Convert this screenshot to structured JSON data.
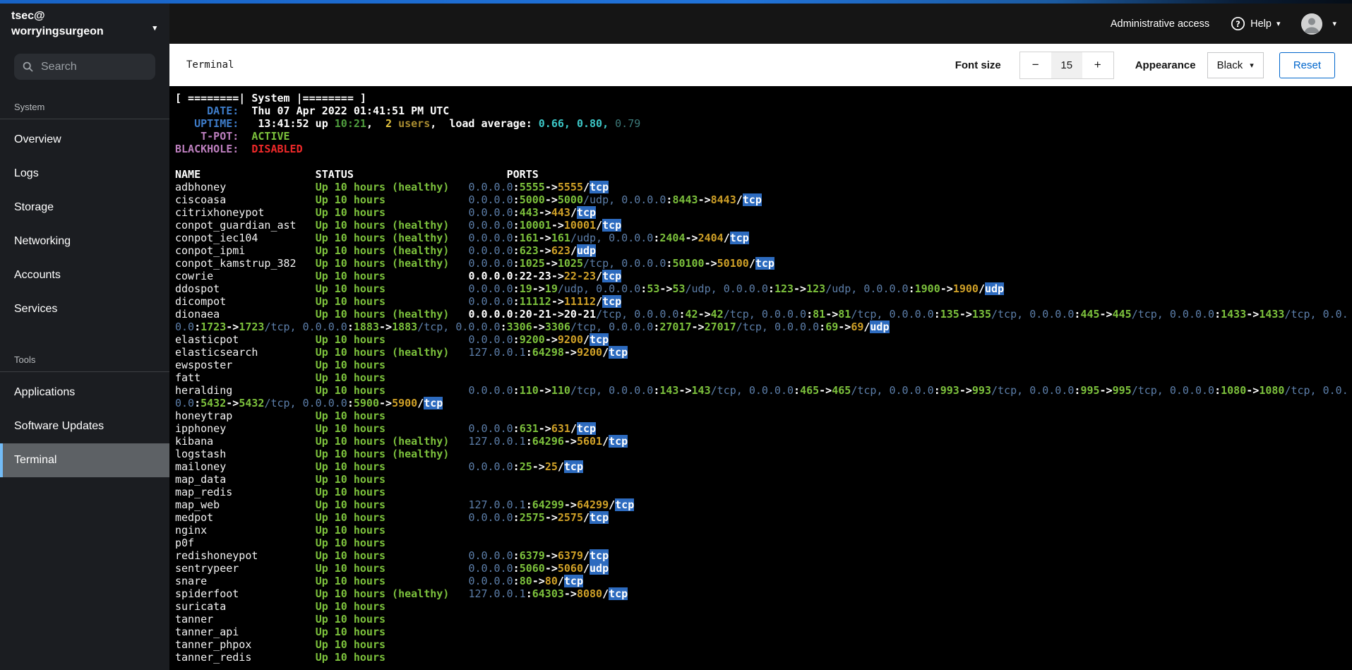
{
  "masthead": {
    "user": "tsec@",
    "host": "worryingsurgeon",
    "admin_access_label": "Administrative access",
    "help_label": "Help"
  },
  "sidebar": {
    "search_placeholder": "Search",
    "sections": [
      {
        "title": "System",
        "items": [
          {
            "label": "Overview",
            "current": false
          },
          {
            "label": "Logs",
            "current": false
          },
          {
            "label": "Storage",
            "current": false
          },
          {
            "label": "Networking",
            "current": false
          },
          {
            "label": "Accounts",
            "current": false
          },
          {
            "label": "Services",
            "current": false
          }
        ]
      },
      {
        "title": "Tools",
        "items": [
          {
            "label": "Applications",
            "current": false
          },
          {
            "label": "Software Updates",
            "current": false
          },
          {
            "label": "Terminal",
            "current": true
          }
        ]
      }
    ]
  },
  "toolbar": {
    "title": "Terminal",
    "font_size_label": "Font size",
    "minus_label": "−",
    "font_size_value": "15",
    "plus_label": "+",
    "appearance_label": "Appearance",
    "appearance_value": "Black",
    "reset_label": "Reset"
  },
  "colors": {
    "accent_blue": "#1863c6",
    "masthead_bg": "#151515",
    "sidebar_bg": "#1b1d21",
    "selected_bg": "#5d6165",
    "selected_border": "#73bcf7",
    "link_blue": "#0066cc",
    "terminal_bg": "#000000",
    "terminal_green": "#7cc13c",
    "terminal_yellow": "#cfa027",
    "terminal_steel_blue": "#5c7ea9",
    "terminal_label_blue": "#3e7cc9",
    "terminal_purple": "#bd7fbe",
    "terminal_red": "#ef2929",
    "terminal_cyan": "#3cc8c8",
    "highlight_bg": "#2d6bbf"
  },
  "terminal": {
    "status_up": "Up 10 hours",
    "status_healthy": "Up 10 hours (healthy)",
    "lines": [
      {
        "segs": [
          [
            "[ ========| System |======== ]",
            "wb"
          ]
        ]
      },
      {
        "segs": [
          [
            "     DATE:",
            "lb"
          ],
          [
            "  Thu 07 Apr 2022 01:41:51 PM UTC",
            "wb"
          ]
        ]
      },
      {
        "segs": [
          [
            "   UPTIME:",
            "lb"
          ],
          [
            "   13:41:52 up ",
            "wb"
          ],
          [
            "10:21",
            "dg"
          ],
          [
            ",  ",
            "wb"
          ],
          [
            "2",
            "by"
          ],
          [
            " ",
            "wb"
          ],
          [
            "users",
            "oy"
          ],
          [
            ",  load average: ",
            "wb"
          ],
          [
            "0.66, ",
            "cy"
          ],
          [
            "0.80, ",
            "cy"
          ],
          [
            "0.79",
            "cyd"
          ]
        ]
      },
      {
        "segs": [
          [
            "    T-POT:",
            "pu"
          ],
          [
            "  ",
            "wb"
          ],
          [
            "ACTIVE",
            "g"
          ]
        ]
      },
      {
        "segs": [
          [
            "BLACKHOLE:",
            "pu"
          ],
          [
            "  ",
            "wb"
          ],
          [
            "DISABLED",
            "r"
          ]
        ]
      },
      {
        "segs": []
      },
      {
        "segs": [
          [
            "NAME                  STATUS                        PORTS",
            "wb"
          ]
        ]
      },
      {
        "name": "adbhoney",
        "healthy": true,
        "ports": [
          [
            "0.0.0.0",
            "5555",
            "5555",
            "tcp",
            "f"
          ]
        ]
      },
      {
        "name": "ciscoasa",
        "healthy": false,
        "ports": [
          [
            "0.0.0.0",
            "5000",
            "5000",
            "udp",
            ""
          ],
          [
            "0.0.0.0",
            "8443",
            "8443",
            "tcp",
            "f"
          ]
        ]
      },
      {
        "name": "citrixhoneypot",
        "healthy": false,
        "ports": [
          [
            "0.0.0.0",
            "443",
            "443",
            "tcp",
            "f"
          ]
        ]
      },
      {
        "name": "conpot_guardian_ast",
        "healthy": true,
        "ports": [
          [
            "0.0.0.0",
            "10001",
            "10001",
            "tcp",
            "f"
          ]
        ]
      },
      {
        "name": "conpot_iec104",
        "healthy": true,
        "ports": [
          [
            "0.0.0.0",
            "161",
            "161",
            "udp",
            ""
          ],
          [
            "0.0.0.0",
            "2404",
            "2404",
            "tcp",
            "f"
          ]
        ]
      },
      {
        "name": "conpot_ipmi",
        "healthy": true,
        "ports": [
          [
            "0.0.0.0",
            "623",
            "623",
            "udp",
            "f"
          ]
        ]
      },
      {
        "name": "conpot_kamstrup_382",
        "healthy": true,
        "ports": [
          [
            "0.0.0.0",
            "1025",
            "1025",
            "tcp",
            ""
          ],
          [
            "0.0.0.0",
            "50100",
            "50100",
            "tcp",
            "f"
          ]
        ]
      },
      {
        "name": "cowrie",
        "healthy": false,
        "ports": [
          [
            "0.0.0.0",
            "22-23",
            "22-23",
            "tcp",
            "fw"
          ]
        ]
      },
      {
        "name": "ddospot",
        "healthy": false,
        "ports": [
          [
            "0.0.0.0",
            "19",
            "19",
            "udp",
            ""
          ],
          [
            "0.0.0.0",
            "53",
            "53",
            "udp",
            ""
          ],
          [
            "0.0.0.0",
            "123",
            "123",
            "udp",
            ""
          ],
          [
            "0.0.0.0",
            "1900",
            "1900",
            "udp",
            "f"
          ]
        ]
      },
      {
        "name": "dicompot",
        "healthy": false,
        "ports": [
          [
            "0.0.0.0",
            "11112",
            "11112",
            "tcp",
            "f"
          ]
        ]
      },
      {
        "name": "dionaea",
        "healthy": true,
        "ports": [
          [
            "0.0.0.0",
            "20-21",
            "20-21",
            "tcp",
            "w"
          ],
          [
            "0.0.0.0",
            "42",
            "42",
            "tcp",
            ""
          ],
          [
            "0.0.0.0",
            "81",
            "81",
            "tcp",
            ""
          ],
          [
            "0.0.0.0",
            "135",
            "135",
            "tcp",
            ""
          ],
          [
            "0.0.0.0",
            "445",
            "445",
            "tcp",
            ""
          ],
          [
            "0.0.0.0",
            "1433",
            "1433",
            "tcp",
            ""
          ]
        ],
        "tail": "0.0."
      },
      {
        "ports": [
          [
            "0.0",
            "1723",
            "1723",
            "tcp",
            ""
          ],
          [
            "0.0.0.0",
            "1883",
            "1883",
            "tcp",
            ""
          ],
          [
            "0.0.0.0",
            "3306",
            "3306",
            "tcp",
            ""
          ],
          [
            "0.0.0.0",
            "27017",
            "27017",
            "tcp",
            ""
          ],
          [
            "0.0.0.0",
            "69",
            "69",
            "udp",
            "f"
          ]
        ]
      },
      {
        "name": "elasticpot",
        "healthy": false,
        "ports": [
          [
            "0.0.0.0",
            "9200",
            "9200",
            "tcp",
            "f"
          ]
        ]
      },
      {
        "name": "elasticsearch",
        "healthy": true,
        "ports": [
          [
            "127.0.0.1",
            "64298",
            "9200",
            "tcp",
            "f"
          ]
        ]
      },
      {
        "name": "ewsposter",
        "healthy": false,
        "ports": []
      },
      {
        "name": "fatt",
        "healthy": false,
        "ports": []
      },
      {
        "name": "heralding",
        "healthy": false,
        "ports": [
          [
            "0.0.0.0",
            "110",
            "110",
            "tcp",
            ""
          ],
          [
            "0.0.0.0",
            "143",
            "143",
            "tcp",
            ""
          ],
          [
            "0.0.0.0",
            "465",
            "465",
            "tcp",
            ""
          ],
          [
            "0.0.0.0",
            "993",
            "993",
            "tcp",
            ""
          ],
          [
            "0.0.0.0",
            "995",
            "995",
            "tcp",
            ""
          ],
          [
            "0.0.0.0",
            "1080",
            "1080",
            "tcp",
            ""
          ]
        ],
        "tail": "0.0."
      },
      {
        "ports": [
          [
            "0.0",
            "5432",
            "5432",
            "tcp",
            ""
          ],
          [
            "0.0.0.0",
            "5900",
            "5900",
            "tcp",
            "f"
          ]
        ]
      },
      {
        "name": "honeytrap",
        "healthy": false,
        "ports": []
      },
      {
        "name": "ipphoney",
        "healthy": false,
        "ports": [
          [
            "0.0.0.0",
            "631",
            "631",
            "tcp",
            "f"
          ]
        ]
      },
      {
        "name": "kibana",
        "healthy": true,
        "ports": [
          [
            "127.0.0.1",
            "64296",
            "5601",
            "tcp",
            "f"
          ]
        ]
      },
      {
        "name": "logstash",
        "healthy": true,
        "ports": []
      },
      {
        "name": "mailoney",
        "healthy": false,
        "ports": [
          [
            "0.0.0.0",
            "25",
            "25",
            "tcp",
            "f"
          ]
        ]
      },
      {
        "name": "map_data",
        "healthy": false,
        "ports": []
      },
      {
        "name": "map_redis",
        "healthy": false,
        "ports": []
      },
      {
        "name": "map_web",
        "healthy": false,
        "ports": [
          [
            "127.0.0.1",
            "64299",
            "64299",
            "tcp",
            "f"
          ]
        ]
      },
      {
        "name": "medpot",
        "healthy": false,
        "ports": [
          [
            "0.0.0.0",
            "2575",
            "2575",
            "tcp",
            "f"
          ]
        ]
      },
      {
        "name": "nginx",
        "healthy": false,
        "ports": []
      },
      {
        "name": "p0f",
        "healthy": false,
        "ports": []
      },
      {
        "name": "redishoneypot",
        "healthy": false,
        "ports": [
          [
            "0.0.0.0",
            "6379",
            "6379",
            "tcp",
            "f"
          ]
        ]
      },
      {
        "name": "sentrypeer",
        "healthy": false,
        "ports": [
          [
            "0.0.0.0",
            "5060",
            "5060",
            "udp",
            "f"
          ]
        ]
      },
      {
        "name": "snare",
        "healthy": false,
        "ports": [
          [
            "0.0.0.0",
            "80",
            "80",
            "tcp",
            "f"
          ]
        ]
      },
      {
        "name": "spiderfoot",
        "healthy": true,
        "ports": [
          [
            "127.0.0.1",
            "64303",
            "8080",
            "tcp",
            "f"
          ]
        ]
      },
      {
        "name": "suricata",
        "healthy": false,
        "ports": []
      },
      {
        "name": "tanner",
        "healthy": false,
        "ports": []
      },
      {
        "name": "tanner_api",
        "healthy": false,
        "ports": []
      },
      {
        "name": "tanner_phpox",
        "healthy": false,
        "ports": []
      },
      {
        "name": "tanner_redis",
        "healthy": false,
        "ports": []
      }
    ]
  }
}
